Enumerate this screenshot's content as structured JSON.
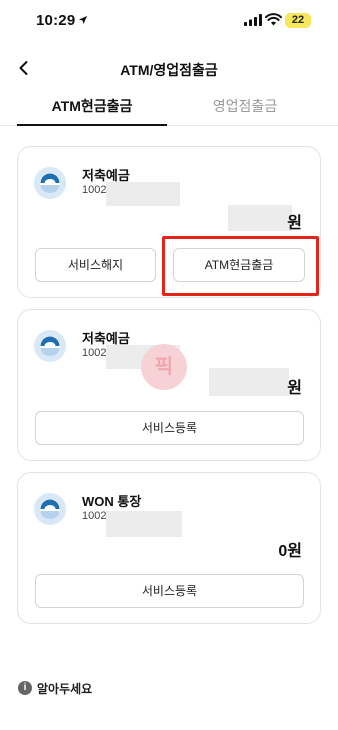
{
  "status_bar": {
    "time": "10:29",
    "battery": "22"
  },
  "nav": {
    "title": "ATM/영업점출금"
  },
  "tabs": [
    {
      "label": "ATM현금출금",
      "active": true
    },
    {
      "label": "영업점출금",
      "active": false
    }
  ],
  "accounts": [
    {
      "name": "저축예금",
      "number_prefix": "1002",
      "balance_unit": "원",
      "buttons": [
        "서비스해지",
        "ATM현금출금"
      ]
    },
    {
      "name": "저축예금",
      "number_prefix": "1002",
      "balance_unit": "원",
      "buttons": [
        "서비스등록"
      ]
    },
    {
      "name": "WON 통장",
      "number_prefix": "1002",
      "balance": "0원",
      "buttons": [
        "서비스등록"
      ]
    }
  ],
  "notice": {
    "label": "알아두세요"
  },
  "colors": {
    "highlight": "#e5231a",
    "accent": "#1f6fb5",
    "battery": "#f7e75b"
  },
  "icons": [
    "location-arrow-icon",
    "signal-icon",
    "wifi-icon",
    "back-arrow-icon",
    "bank-logo-icon",
    "info-icon"
  ]
}
